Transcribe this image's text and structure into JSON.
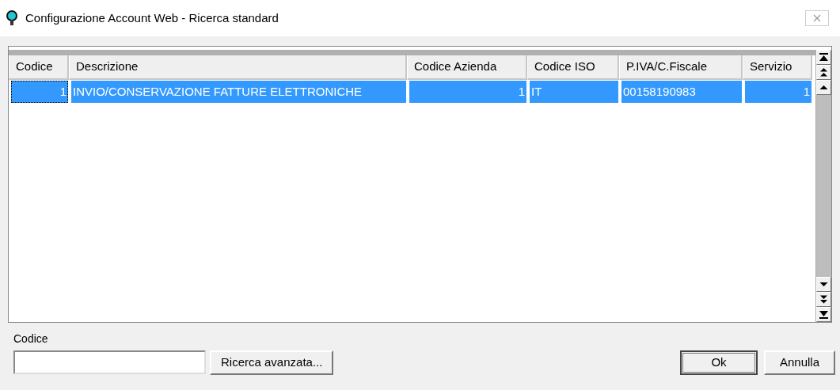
{
  "window": {
    "title": "Configurazione Account Web - Ricerca standard"
  },
  "table": {
    "columns": [
      {
        "label": "Codice",
        "kind": "number"
      },
      {
        "label": "Descrizione",
        "kind": "text"
      },
      {
        "label": "Codice Azienda",
        "kind": "number"
      },
      {
        "label": "Codice ISO",
        "kind": "text"
      },
      {
        "label": "P.IVA/C.Fiscale",
        "kind": "text"
      },
      {
        "label": "Servizio",
        "kind": "number"
      }
    ],
    "rows": [
      {
        "selected": true,
        "cells": [
          "1",
          "INVIO/CONSERVAZIONE FATTURE ELETTRONICHE",
          "1",
          "IT",
          "00158190983",
          "1"
        ]
      }
    ]
  },
  "search": {
    "label": "Codice",
    "button": "Ricerca avanzata..."
  },
  "buttons": [
    {
      "label": "Ok",
      "default": true
    },
    {
      "label": "Annulla",
      "default": false
    }
  ]
}
